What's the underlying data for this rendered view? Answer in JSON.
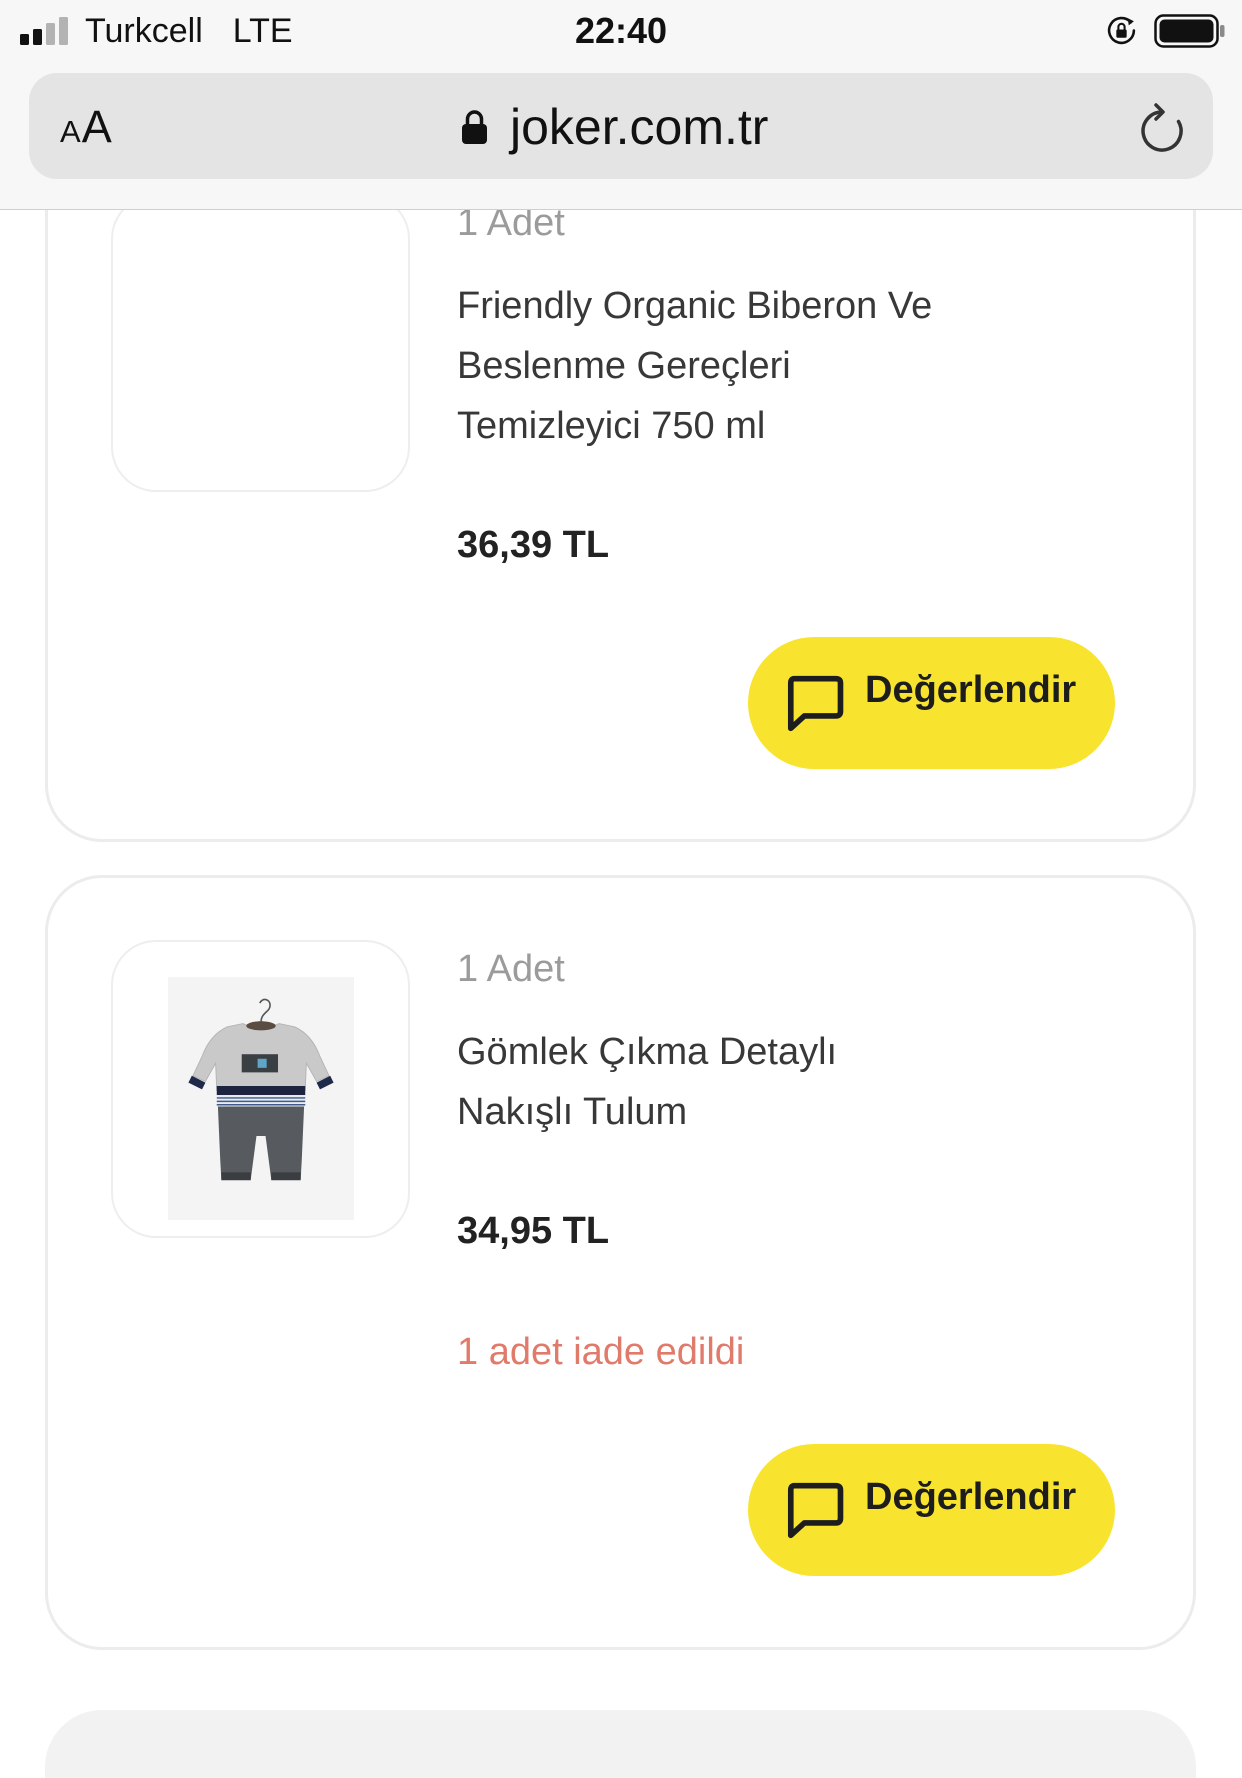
{
  "status_bar": {
    "carrier": "Turkcell",
    "network": "LTE",
    "time": "22:40",
    "icons": [
      "signal-bars-icon",
      "orientation-lock-icon",
      "battery-icon"
    ]
  },
  "browser_bar": {
    "text_size_small": "A",
    "text_size_large": "A",
    "url": "joker.com.tr",
    "icons": [
      "lock-icon",
      "reload-icon"
    ]
  },
  "orders": [
    {
      "quantity": "1 Adet",
      "name": "Friendly Organic Biberon Ve Beslenme Gereçleri Temizleyici 750 ml",
      "price": "36,39 TL",
      "rate_button": {
        "label": "Değerlendir",
        "icon": "chat-bubble-icon"
      }
    },
    {
      "quantity": "1 Adet",
      "name": "Gömlek Çıkma Detaylı Nakışlı Tulum",
      "price": "34,95 TL",
      "return_status": "1 adet iade edildi",
      "rate_button": {
        "label": "Değerlendir",
        "icon": "chat-bubble-icon"
      }
    }
  ],
  "colors": {
    "accent": "#f8e42f",
    "return_status": "#e07b6c",
    "text": "#383838",
    "muted": "#9b9b9b"
  }
}
